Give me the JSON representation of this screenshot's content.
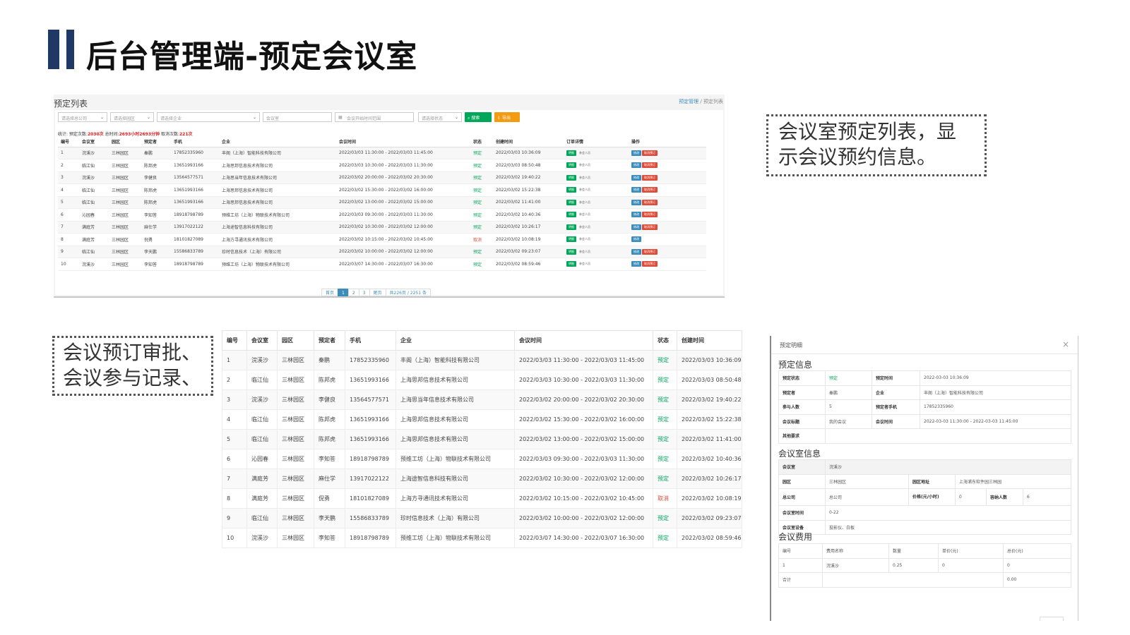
{
  "slide": {
    "title": "后台管理端-预定会议室",
    "callout_top": [
      "会议室预定列表，显",
      "示会议预约信息。"
    ],
    "callout_left": [
      "会议预订审批、",
      "会议参与记录、"
    ]
  },
  "list_view": {
    "title": "预定列表",
    "breadcrumb": {
      "link": "预定管理",
      "sep": "/",
      "current": "预定列表"
    },
    "filters": {
      "company": "请选择总公司",
      "park": "请选择园区",
      "enterprise": "请选择企业",
      "room_placeholder": "会议室",
      "time_range_placeholder": "会议开始时间范围",
      "status": "请选择状态",
      "search_button": "搜索",
      "export_button": "导出"
    },
    "stats": {
      "label_total": "统计: 预定次数:",
      "total": "2030次",
      "label_duration": "总时间:",
      "duration": "2693小时2693分钟",
      "label_cancel": "取消次数:",
      "cancel": "221次"
    },
    "columns": [
      "编号",
      "会议室",
      "园区",
      "预定者",
      "手机",
      "企业",
      "会议时间",
      "状态",
      "创建时间",
      "订单详情",
      "操作"
    ],
    "actions": {
      "detail": "明细",
      "participants": "参会人员",
      "edit": "修改",
      "cancel": "取消预订"
    },
    "pager": {
      "first": "首页",
      "pages": [
        "1",
        "2",
        "3"
      ],
      "last": "尾页",
      "summary": "共226页 / 2251 条"
    }
  },
  "rows": [
    {
      "id": "1",
      "room": "浣溪沙",
      "park": "三林园区",
      "booker": "秦鹏",
      "phone": "17852335960",
      "company": "丰阁（上海）智能科技有限公司",
      "time": "2022/03/03 11:30:00 - 2022/03/03 11:45:00",
      "status": "预定",
      "created": "2022/03/03 10:36:09"
    },
    {
      "id": "2",
      "room": "临江仙",
      "park": "三林园区",
      "booker": "陈邦虎",
      "phone": "13651993166",
      "company": "上海思邦信息技术有限公司",
      "time": "2022/03/03 10:30:00 - 2022/03/03 11:30:00",
      "status": "预定",
      "created": "2022/03/03 08:50:48"
    },
    {
      "id": "3",
      "room": "浣溪沙",
      "park": "三林园区",
      "booker": "李健良",
      "phone": "13564577571",
      "company": "上海思当年信息技术有限公司",
      "time": "2022/03/02 20:00:00 - 2022/03/02 20:30:00",
      "status": "预定",
      "created": "2022/03/02 19:40:22"
    },
    {
      "id": "4",
      "room": "临江仙",
      "park": "三林园区",
      "booker": "陈邦虎",
      "phone": "13651993166",
      "company": "上海思邦信息技术有限公司",
      "time": "2022/03/02 15:30:00 - 2022/03/02 16:00:00",
      "status": "预定",
      "created": "2022/03/02 15:22:38"
    },
    {
      "id": "5",
      "room": "临江仙",
      "park": "三林园区",
      "booker": "陈邦虎",
      "phone": "13651993166",
      "company": "上海思邦信息技术有限公司",
      "time": "2022/03/02 13:00:00 - 2022/03/02 15:00:00",
      "status": "预定",
      "created": "2022/03/02 11:41:00"
    },
    {
      "id": "6",
      "room": "沁园春",
      "park": "三林园区",
      "booker": "李知答",
      "phone": "18918798789",
      "company": "预维工坊（上海）物联技术有限公司",
      "time": "2022/03/03 09:30:00 - 2022/03/03 11:30:00",
      "status": "预定",
      "created": "2022/03/02 10:40:36"
    },
    {
      "id": "7",
      "room": "满庭芳",
      "park": "三林园区",
      "booker": "麻仕学",
      "phone": "13917022122",
      "company": "上海途智信息科技有限公司",
      "time": "2022/03/02 10:30:00 - 2022/03/02 12:00:00",
      "status": "预定",
      "created": "2022/03/02 10:26:17"
    },
    {
      "id": "8",
      "room": "满庭芳",
      "park": "三林园区",
      "booker": "倪勇",
      "phone": "18101827089",
      "company": "上海方寻通讯技术有限公司",
      "time": "2022/03/02 10:15:00 - 2022/03/02 10:45:00",
      "status": "取消",
      "created": "2022/03/02 10:08:19"
    },
    {
      "id": "9",
      "room": "临江仙",
      "park": "三林园区",
      "booker": "李天鹏",
      "phone": "15586833789",
      "company": "珍时信息技术（上海）有限公司",
      "time": "2022/03/02 10:00:00 - 2022/03/02 12:00:00",
      "status": "预定",
      "created": "2022/03/02 09:23:07"
    },
    {
      "id": "10",
      "room": "浣溪沙",
      "park": "三林园区",
      "booker": "李知答",
      "phone": "18918798789",
      "company": "预维工坊（上海）物联技术有限公司",
      "time": "2022/03/07 14:30:00 - 2022/03/07 16:30:00",
      "status": "预定",
      "created": "2022/03/02 08:59:46"
    }
  ],
  "table_view": {
    "columns": [
      "编号",
      "会议室",
      "园区",
      "预定者",
      "手机",
      "企业",
      "会议时间",
      "状态",
      "创建时间"
    ]
  },
  "detail": {
    "modal_title": "预定明细",
    "close": "×",
    "booking_section": "预定信息",
    "booking": {
      "status_label": "预定状态",
      "status": "预定",
      "time_label": "预定时间",
      "time": "2022-03-03 10:36:09",
      "booker_label": "预定者",
      "booker": "秦鹏",
      "company_label": "企业",
      "company": "丰阁（上海）智能科技有限公司",
      "people_label": "参与人数",
      "people": "5",
      "phone_label": "预定者手机",
      "phone": "17852335960",
      "topic_label": "会议标题",
      "topic": "我的会议",
      "meeting_time_label": "会议时间",
      "meeting_time": "2022-03-03 11:30:00 - 2022-03-03 11:45:00",
      "other_label": "其他要求",
      "other": ""
    },
    "room_section": "会议室信息",
    "room": {
      "room_label": "会议室",
      "room": "浣溪沙",
      "park_label": "园区",
      "park": "三林园区",
      "address_label": "园区地址",
      "address": "上海浦东软件园三林园",
      "company_label": "总公司",
      "company": "总公司",
      "price_label": "价格(元/小时)",
      "price": "0",
      "capacity_label": "容纳人数",
      "capacity": "6",
      "hours_label": "会议室时间",
      "hours": "0-22",
      "equipment_label": "会议室设备",
      "equipment": "投影仪、白板"
    },
    "fee_section": "会议费用",
    "fee_columns": [
      "编号",
      "费用名称",
      "数量",
      "单价(元)",
      "总价(元)"
    ],
    "fee_rows": [
      [
        "1",
        "浣溪沙",
        "0.25",
        "0",
        "0"
      ]
    ],
    "fee_total_label": "合计",
    "fee_total": "0.00"
  },
  "colors": {
    "title_bar": "#1f3864",
    "ok": "#00a65a",
    "cancel": "#dd4b39",
    "primary": "#3c8dbc",
    "warning": "#f39c12"
  }
}
